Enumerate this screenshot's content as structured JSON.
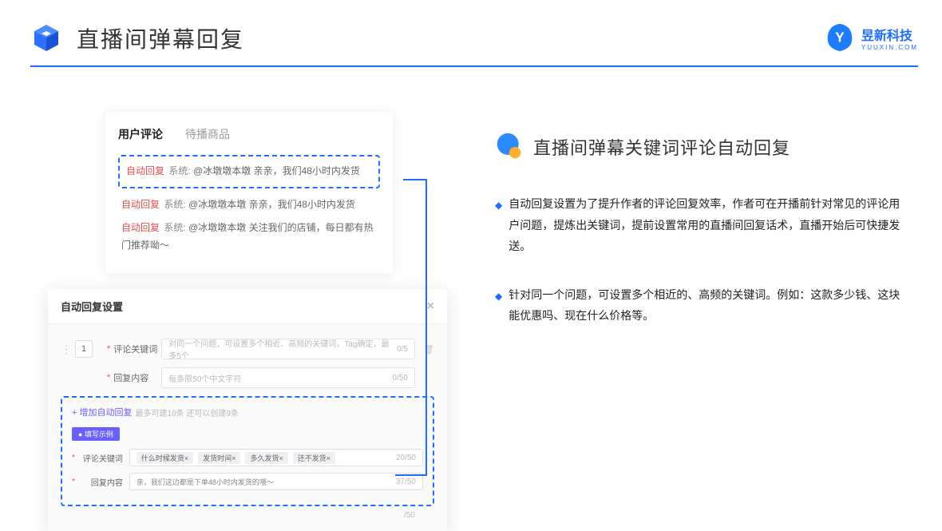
{
  "header": {
    "title": "直播间弹幕回复",
    "brand_name": "昱新科技",
    "brand_sub": "YUUXIN.COM"
  },
  "card1": {
    "tabs": {
      "active": "用户评论",
      "inactive": "待播商品"
    },
    "highlight": {
      "tag": "自动回复",
      "sys": "系统:",
      "text": "@冰墩墩本墩 亲亲，我们48小时内发货"
    },
    "list": [
      {
        "tag": "自动回复",
        "sys": "系统:",
        "text": "@冰墩墩本墩 亲亲，我们48小时内发货"
      },
      {
        "tag": "自动回复",
        "sys": "系统:",
        "text": "@冰墩墩本墩 关注我们的店铺，每日都有热门推荐呦～"
      }
    ]
  },
  "card2": {
    "title": "自动回复设置",
    "order": "1",
    "row1": {
      "label": "评论关键词",
      "placeholder": "对同一个问题，可设置多个相近、高频的关键词，Tag确定，最多5个",
      "count": "0/5"
    },
    "row2": {
      "label": "回复内容",
      "placeholder": "每条限50个中文字符",
      "count": "0/50"
    },
    "add": {
      "link": "+ 增加自动回复",
      "note": "最多可建10条 还可以创建9条"
    },
    "example": {
      "badge": "● 填写示例",
      "r1": {
        "label": "评论关键词",
        "tags": [
          "什么时候发货×",
          "发货时间×",
          "多久发货×",
          "还不发货×"
        ],
        "count": "20/50"
      },
      "r2": {
        "label": "回复内容",
        "text": "亲，我们这边都是下单48小时内发货的哦～",
        "count": "37/50"
      }
    },
    "footer_count": "/50"
  },
  "right": {
    "title": "直播间弹幕关键词评论自动回复",
    "b1": "自动回复设置为了提升作者的评论回复效率，作者可在开播前针对常见的评论用户问题，提炼出关键词，提前设置常用的直播间回复话术，直播开始后可快捷发送。",
    "b2": "针对同一个问题，可设置多个相近的、高频的关键词。例如：这款多少钱、这块能优惠吗、现在什么价格等。"
  }
}
